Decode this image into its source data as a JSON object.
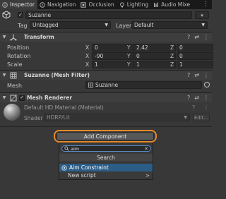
{
  "tabs": [
    {
      "label": "Inspector",
      "icon": "info-icon",
      "active": true
    },
    {
      "label": "Navigation",
      "icon": "compass-icon",
      "active": false
    },
    {
      "label": "Occlusion",
      "icon": "occlusion-icon",
      "active": false
    },
    {
      "label": "Lighting",
      "icon": "bulb-icon",
      "active": false
    },
    {
      "label": "Audio Mixe",
      "icon": "audio-mixer-icon",
      "active": false
    }
  ],
  "tab_more": "⋮",
  "object": {
    "name": "Suzanne",
    "active": true,
    "static_arrow": "▾",
    "tag_label": "Tag",
    "tag_value": "Untagged",
    "layer_label": "Layer",
    "layer_value": "Default"
  },
  "transform": {
    "title": "Transform",
    "position_label": "Position",
    "rotation_label": "Rotation",
    "scale_label": "Scale",
    "axis_x": "X",
    "axis_y": "Y",
    "axis_z": "Z",
    "position": {
      "x": "0",
      "y": "2.42",
      "z": "0"
    },
    "rotation": {
      "x": "-90",
      "y": "0",
      "z": "0"
    },
    "scale": {
      "x": "1",
      "y": "1",
      "z": "1"
    }
  },
  "mesh_filter": {
    "title": "Suzanne (Mesh Filter)",
    "mesh_label": "Mesh",
    "mesh_value": "Suzanne"
  },
  "mesh_renderer": {
    "title": "Mesh Renderer",
    "enabled": true
  },
  "material": {
    "name": "Default HD Material (Material)",
    "shader_label": "Shader",
    "shader_value": "HDRP/Lit",
    "edit_label": "Edit..."
  },
  "header_icons": {
    "help": "?",
    "preset": "⇄",
    "menu": "⋮"
  },
  "add_component": {
    "label": "Add Component"
  },
  "popup": {
    "search_value": "aim",
    "title": "Search",
    "items": [
      {
        "label": "Aim Constraint",
        "selected": true
      },
      {
        "label": "New script",
        "selected": false
      }
    ]
  },
  "colors": {
    "accent_highlight": "#e58a2c",
    "selection": "#2c5d87",
    "panel": "#383838"
  }
}
